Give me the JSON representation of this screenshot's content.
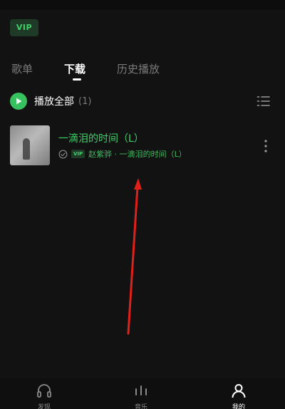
{
  "vip": {
    "label": "VIP"
  },
  "tabs": [
    {
      "label": "歌单"
    },
    {
      "label": "下载"
    },
    {
      "label": "历史播放"
    }
  ],
  "play_all": {
    "label": "播放全部",
    "count": "(1)"
  },
  "songs": [
    {
      "title": "一滴泪的时间（L）",
      "vip_tag": "VIP",
      "subtitle": "赵紫骅 · 一滴泪的时间（L）"
    }
  ],
  "bottom_nav": [
    {
      "label": "发现",
      "icon": "headphones-icon"
    },
    {
      "label": "音乐",
      "icon": "equalizer-icon"
    },
    {
      "label": "我的",
      "icon": "person-icon"
    }
  ],
  "colors": {
    "accent": "#3fd16a",
    "background": "#121212",
    "arrow": "#e0201a"
  }
}
